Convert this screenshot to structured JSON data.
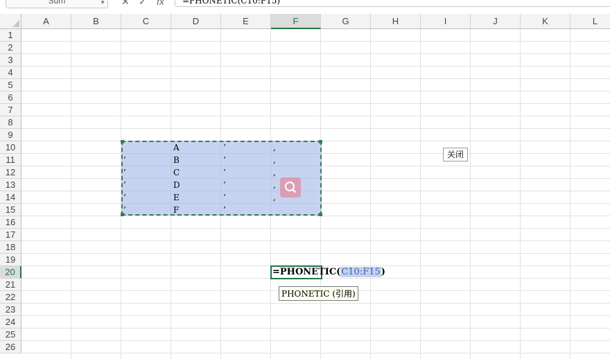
{
  "formula_bar": {
    "name_box": "Sum",
    "cancel_icon": "✕",
    "confirm_icon": "✓",
    "fx_label": "fx",
    "formula": "=PHONETIC(C10:F15)"
  },
  "columns": [
    "A",
    "B",
    "C",
    "D",
    "E",
    "F",
    "G",
    "H",
    "I",
    "J",
    "K",
    "L"
  ],
  "active_column": "F",
  "rows": [
    "1",
    "2",
    "3",
    "4",
    "5",
    "6",
    "7",
    "8",
    "9",
    "10",
    "11",
    "12",
    "13",
    "14",
    "15",
    "16",
    "17",
    "18",
    "19",
    "20",
    "21",
    "22",
    "23",
    "24",
    "25",
    "26"
  ],
  "active_row": "20",
  "cells": {
    "C11": "’",
    "C12": "’",
    "C13": "’",
    "C14": "’",
    "C15": "’",
    "D10": "A",
    "D11": "B",
    "D12": "C",
    "D13": "D",
    "D14": "E",
    "D15": "F",
    "E10": "’",
    "E11": "’",
    "E12": "’",
    "E13": "’",
    "E14": "’",
    "E15": "’",
    "F10": ",",
    "F11": ",",
    "F12": ",",
    "F13": ",",
    "F14": ","
  },
  "close_button": "关闭",
  "search_icon": "magnifier-icon",
  "editing": {
    "cell": "F20",
    "prefix": "=PHONETIC(",
    "reference": "C10:F15",
    "suffix": ")",
    "tooltip": "PHONETIC (引用)"
  },
  "colors": {
    "selection": "#9eb6e8",
    "accent": "#217346",
    "overlay": "#e08ca0"
  }
}
